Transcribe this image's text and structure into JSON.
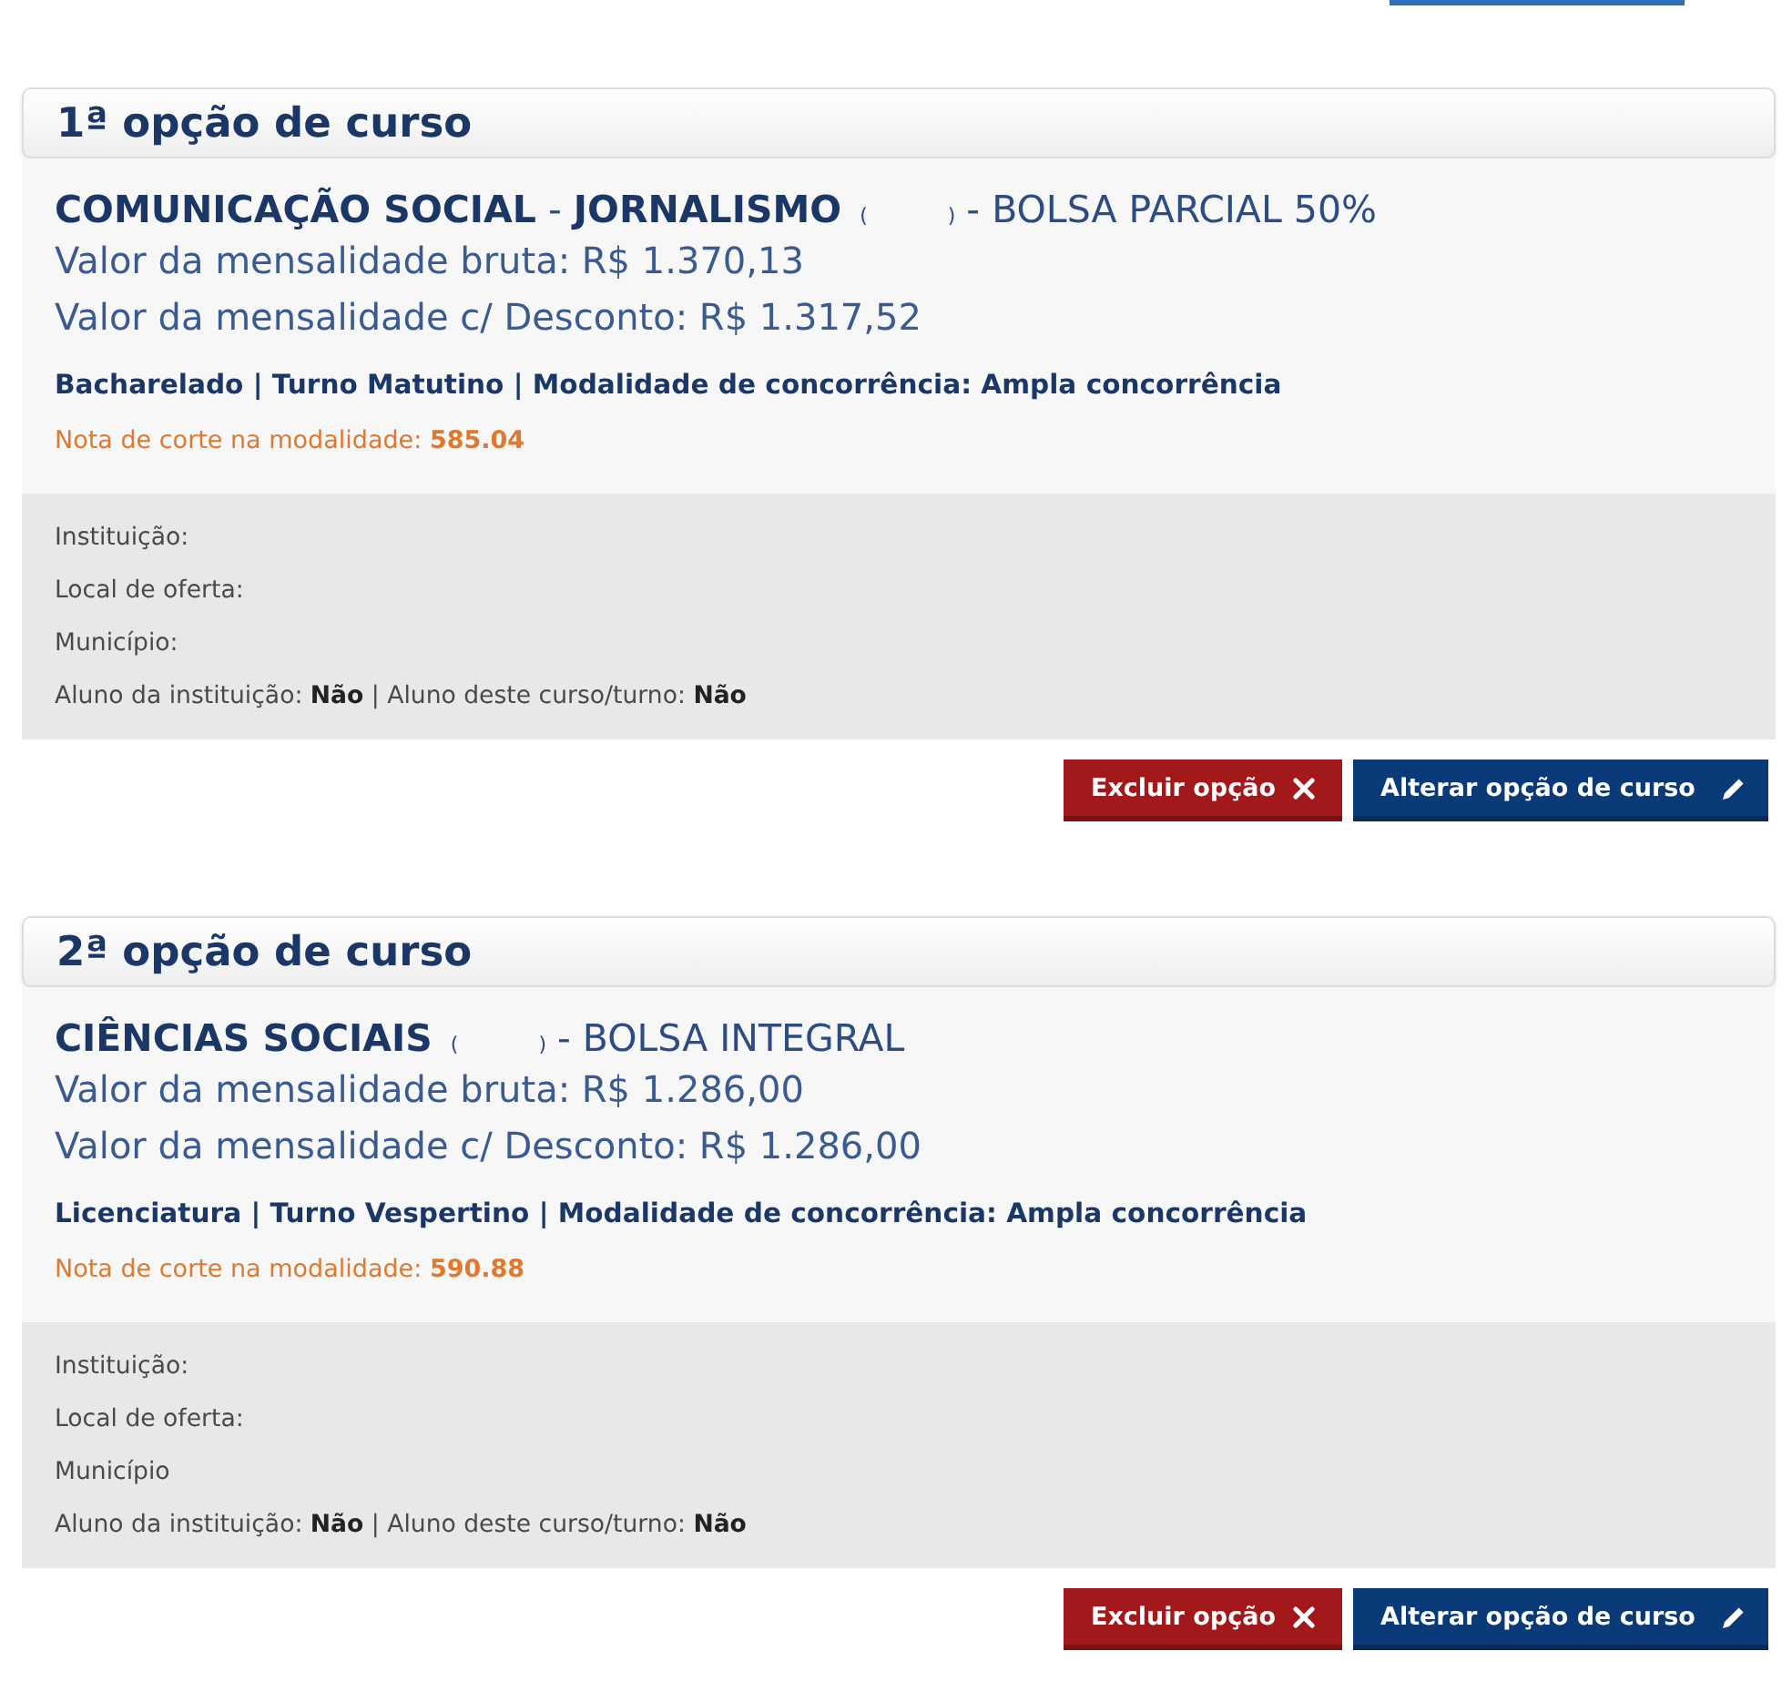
{
  "options": [
    {
      "heading": "1ª opção de curso",
      "course": {
        "name": "**COMUNICAÇÃO SOCIAL** - **JORNALISMO**",
        "paren_open": "(",
        "paren_close": ")",
        "scholarship": "- BOLSA PARCIAL 50%"
      },
      "prices": [
        "Valor da mensalidade bruta: R$ 1.370,13",
        "Valor da mensalidade c/ Desconto: R$ 1.317,52"
      ],
      "details": "Bacharelado | Turno Matutino | Modalidade de concorrência: Ampla concorrência",
      "cutoff": "Nota de corte na modalidade: **585.04**",
      "info": [
        "Instituição:",
        "Local de oferta:",
        "Município:",
        "Aluno da instituição: **Não** | Aluno deste curso/turno: **Não**"
      ],
      "buttons": [
        {
          "kind": "delete",
          "label": "Excluir opção"
        },
        {
          "kind": "edit",
          "label": "Alterar opção de curso"
        }
      ]
    },
    {
      "heading": "2ª opção de curso",
      "course": {
        "name": "**CIÊNCIAS SOCIAIS**",
        "paren_open": "(",
        "paren_close": ")",
        "scholarship": "- BOLSA INTEGRAL"
      },
      "prices": [
        "Valor da mensalidade bruta: R$ 1.286,00",
        "Valor da mensalidade c/ Desconto: R$ 1.286,00"
      ],
      "details": "Licenciatura | Turno Vespertino | Modalidade de concorrência: Ampla concorrência",
      "cutoff": "Nota de corte na modalidade: **590.88**",
      "info": [
        "Instituição:",
        "Local de oferta:",
        "Município",
        "Aluno da instituição: **Não** | Aluno deste curso/turno: **Não**"
      ],
      "buttons": [
        {
          "kind": "delete",
          "label": "Excluir opção"
        },
        {
          "kind": "edit",
          "label": "Alterar opção de curso"
        }
      ]
    }
  ]
}
